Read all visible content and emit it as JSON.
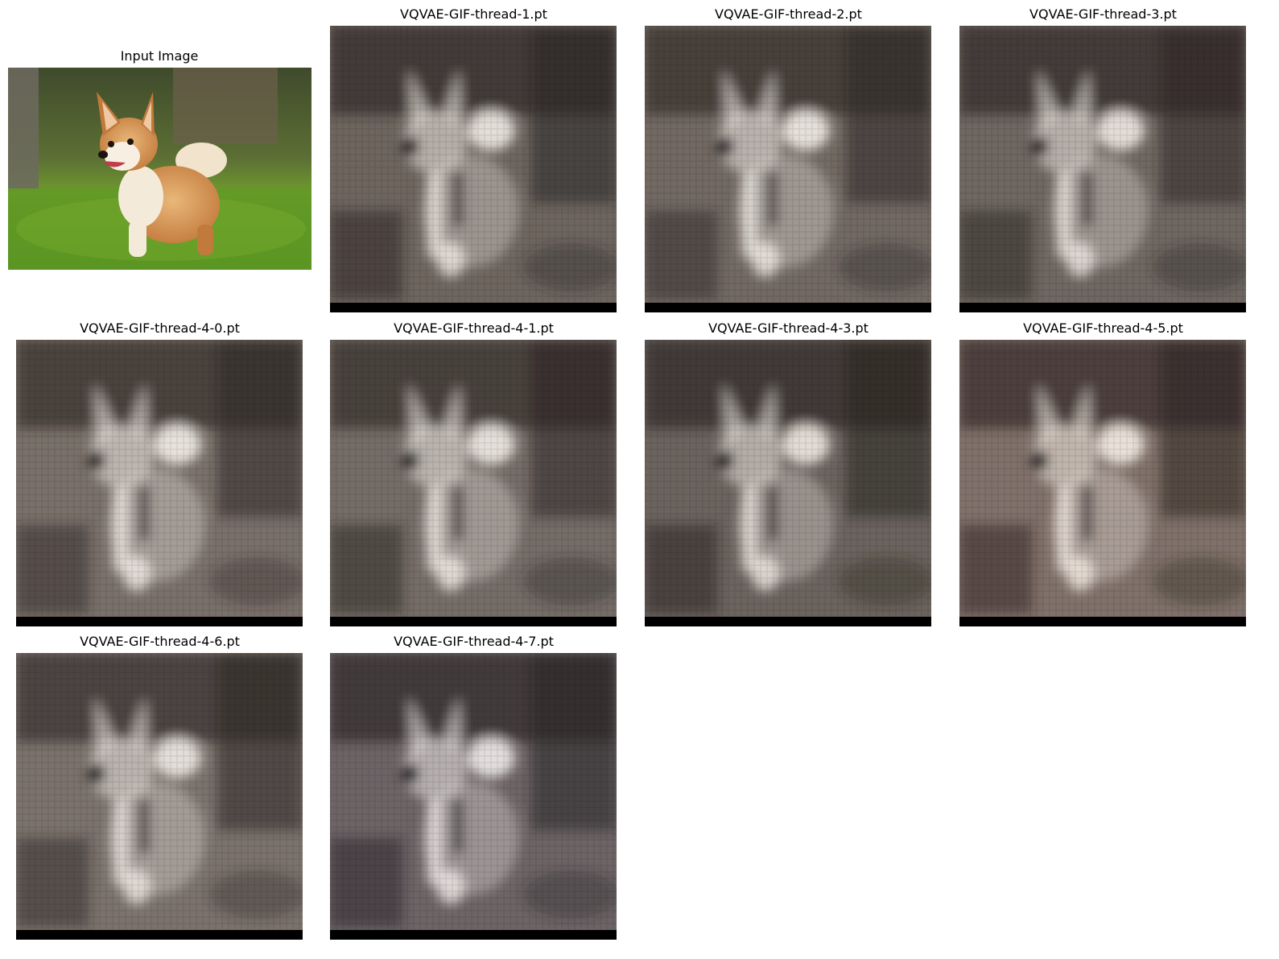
{
  "figure": {
    "input": {
      "title": "Input Image",
      "alt": "corgi running on grass"
    },
    "reconstructions": [
      {
        "title": "VQVAE-GIF-thread-1.pt",
        "tint": "#6e655f",
        "dark": "#2c2624",
        "light": "#f0ebe4"
      },
      {
        "title": "VQVAE-GIF-thread-2.pt",
        "tint": "#726963",
        "dark": "#2f2927",
        "light": "#f2ede7"
      },
      {
        "title": "VQVAE-GIF-thread-3.pt",
        "tint": "#6f6761",
        "dark": "#2d2725",
        "light": "#efe9e3"
      },
      {
        "title": "VQVAE-GIF-thread-4-0.pt",
        "tint": "#7a706a",
        "dark": "#302a27",
        "light": "#f3eee8"
      },
      {
        "title": "VQVAE-GIF-thread-4-1.pt",
        "tint": "#756c67",
        "dark": "#2e2826",
        "light": "#f1ece6"
      },
      {
        "title": "VQVAE-GIF-thread-4-3.pt",
        "tint": "#6b635e",
        "dark": "#2a2422",
        "light": "#efe9e2"
      },
      {
        "title": "VQVAE-GIF-thread-4-5.pt",
        "tint": "#80716a",
        "dark": "#2f2623",
        "light": "#f4ece4"
      },
      {
        "title": "VQVAE-GIF-thread-4-6.pt",
        "tint": "#7b726c",
        "dark": "#302a28",
        "light": "#efeae4"
      },
      {
        "title": "VQVAE-GIF-thread-4-7.pt",
        "tint": "#6d6466",
        "dark": "#2b2527",
        "light": "#f0ebea"
      }
    ]
  }
}
